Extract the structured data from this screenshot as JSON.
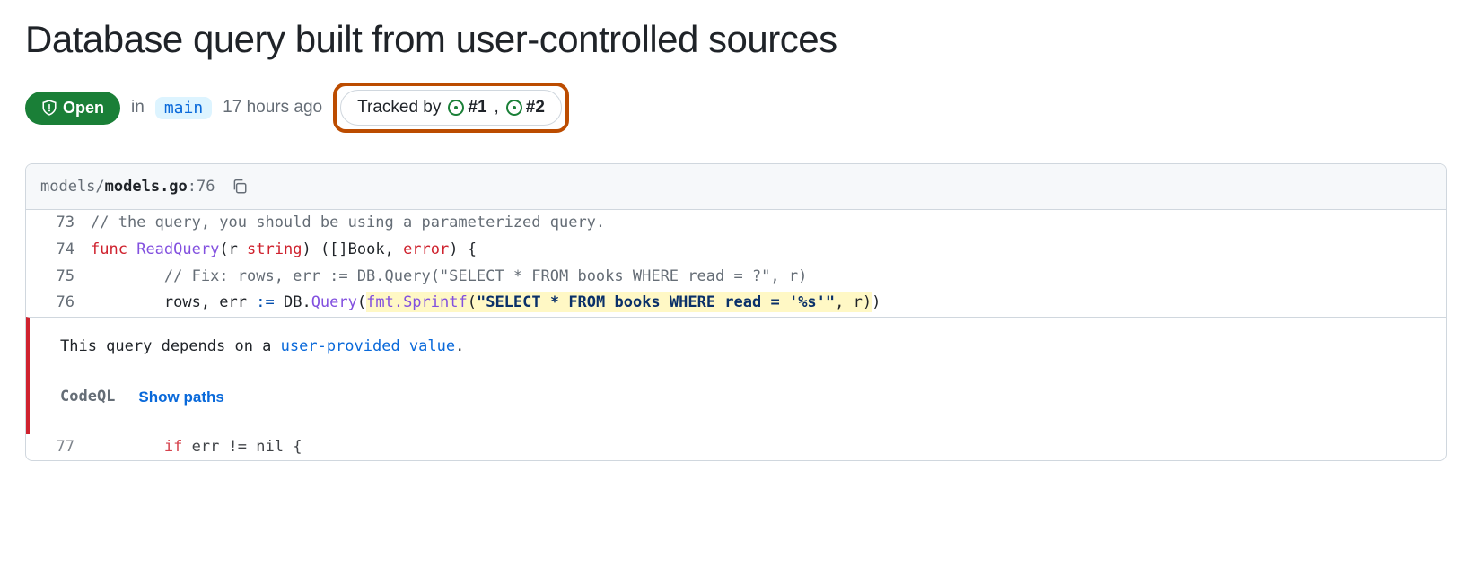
{
  "title": "Database query built from user-controlled sources",
  "status": {
    "label": "Open"
  },
  "meta": {
    "in": "in",
    "branch": "main",
    "age": "17 hours ago"
  },
  "tracked": {
    "label": "Tracked by",
    "issues": [
      {
        "ref": "#1"
      },
      {
        "ref": "#2"
      }
    ],
    "sep": ","
  },
  "file": {
    "path": "models/",
    "name": "models.go",
    "sep": ":",
    "line": "76"
  },
  "code": {
    "lines": [
      {
        "n": "73",
        "comment": "// the query, you should be using a parameterized query."
      },
      {
        "n": "74",
        "kw": "func",
        "fn": "ReadQuery",
        "rest1": "(r ",
        "rest2": "string",
        "rest3": ") ([]Book, ",
        "rest4": "error",
        "rest5": ") {"
      },
      {
        "n": "75",
        "comment": "// Fix: rows, err := DB.Query(\"SELECT * FROM books WHERE read = ?\", r)"
      },
      {
        "n": "76",
        "pre": "rows, err ",
        "op": ":=",
        "mid": " DB.",
        "call1": "Query",
        "open": "(",
        "hl_call": "fmt.Sprintf",
        "hl_open": "(",
        "hl_str": "\"SELECT * FROM books WHERE read = '%s'\"",
        "hl_tail": ", r)",
        "close": ")"
      },
      {
        "n": "77",
        "kw": "if",
        "rest": " err != nil {"
      }
    ]
  },
  "finding": {
    "text_pre": "This query depends on a ",
    "link_text": "user-provided value",
    "text_post": ".",
    "tool": "CodeQL",
    "show_paths": "Show paths"
  }
}
